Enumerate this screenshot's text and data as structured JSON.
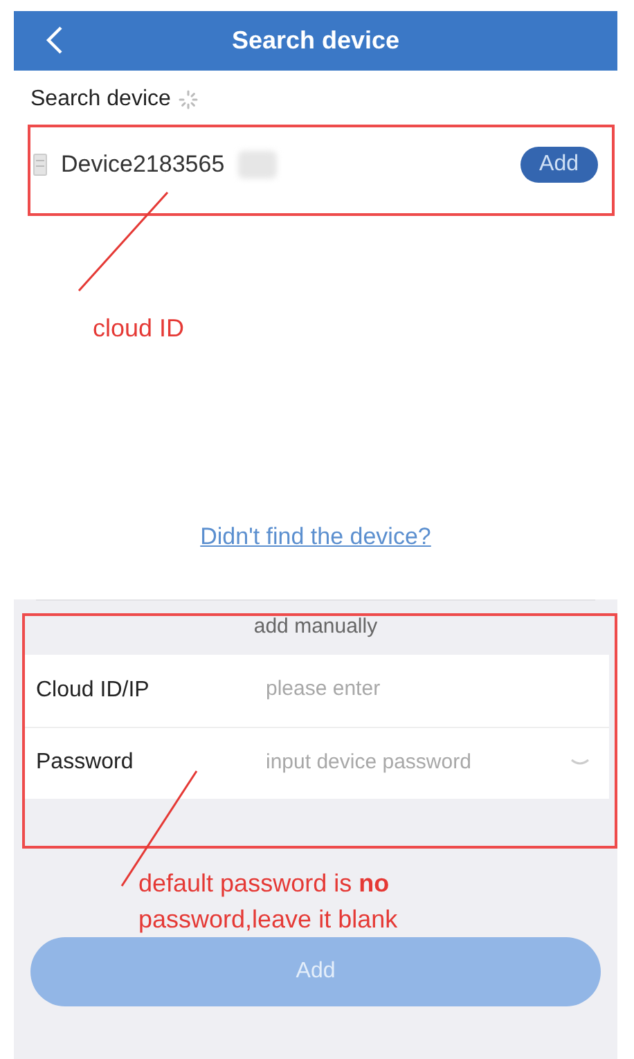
{
  "header": {
    "title": "Search device"
  },
  "search_label": "Search device",
  "devices": [
    {
      "name": "Device2183565",
      "add_label": "Add"
    }
  ],
  "not_found_link": "Didn't find the device?",
  "manual": {
    "title": "add manually",
    "fields": [
      {
        "label": "Cloud ID/IP",
        "placeholder": "please enter",
        "kind": "text"
      },
      {
        "label": "Password",
        "placeholder": "input device password",
        "kind": "password"
      }
    ]
  },
  "submit": {
    "label": "Add",
    "disabled": true
  },
  "annotations": [
    {
      "text": "cloud ID"
    },
    {
      "text": "default password is **no** password,leave it blank"
    }
  ]
}
